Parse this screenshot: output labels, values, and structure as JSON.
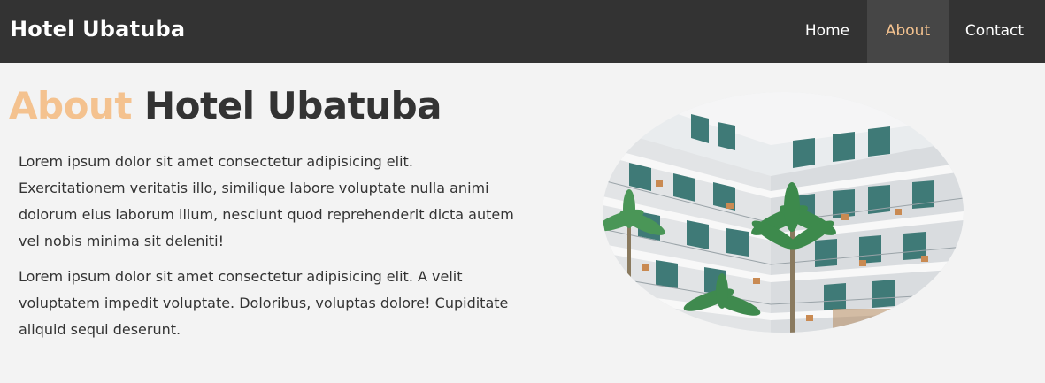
{
  "navbar": {
    "brand": "Hotel Ubatuba",
    "links": [
      {
        "label": "Home",
        "active": false
      },
      {
        "label": "About",
        "active": true
      },
      {
        "label": "Contact",
        "active": false
      }
    ]
  },
  "main": {
    "heading_accent": "About",
    "heading_rest": "Hotel Ubatuba",
    "paragraphs": [
      "Lorem ipsum dolor sit amet consectetur adipisicing elit. Exercitationem veritatis illo, similique labore voluptate nulla animi dolorum eius laborum illum, nesciunt quod reprehenderit dicta autem vel nobis minima sit deleniti!",
      "Lorem ipsum dolor sit amet consectetur adipisicing elit. A velit voluptatem impedit voluptate. Doloribus, voluptas dolore! Cupiditate aliquid sequi deserunt."
    ]
  },
  "colors": {
    "navbar_bg": "#333333",
    "accent": "#f4c28f",
    "page_bg": "#f3f3f3",
    "text": "#333333"
  }
}
